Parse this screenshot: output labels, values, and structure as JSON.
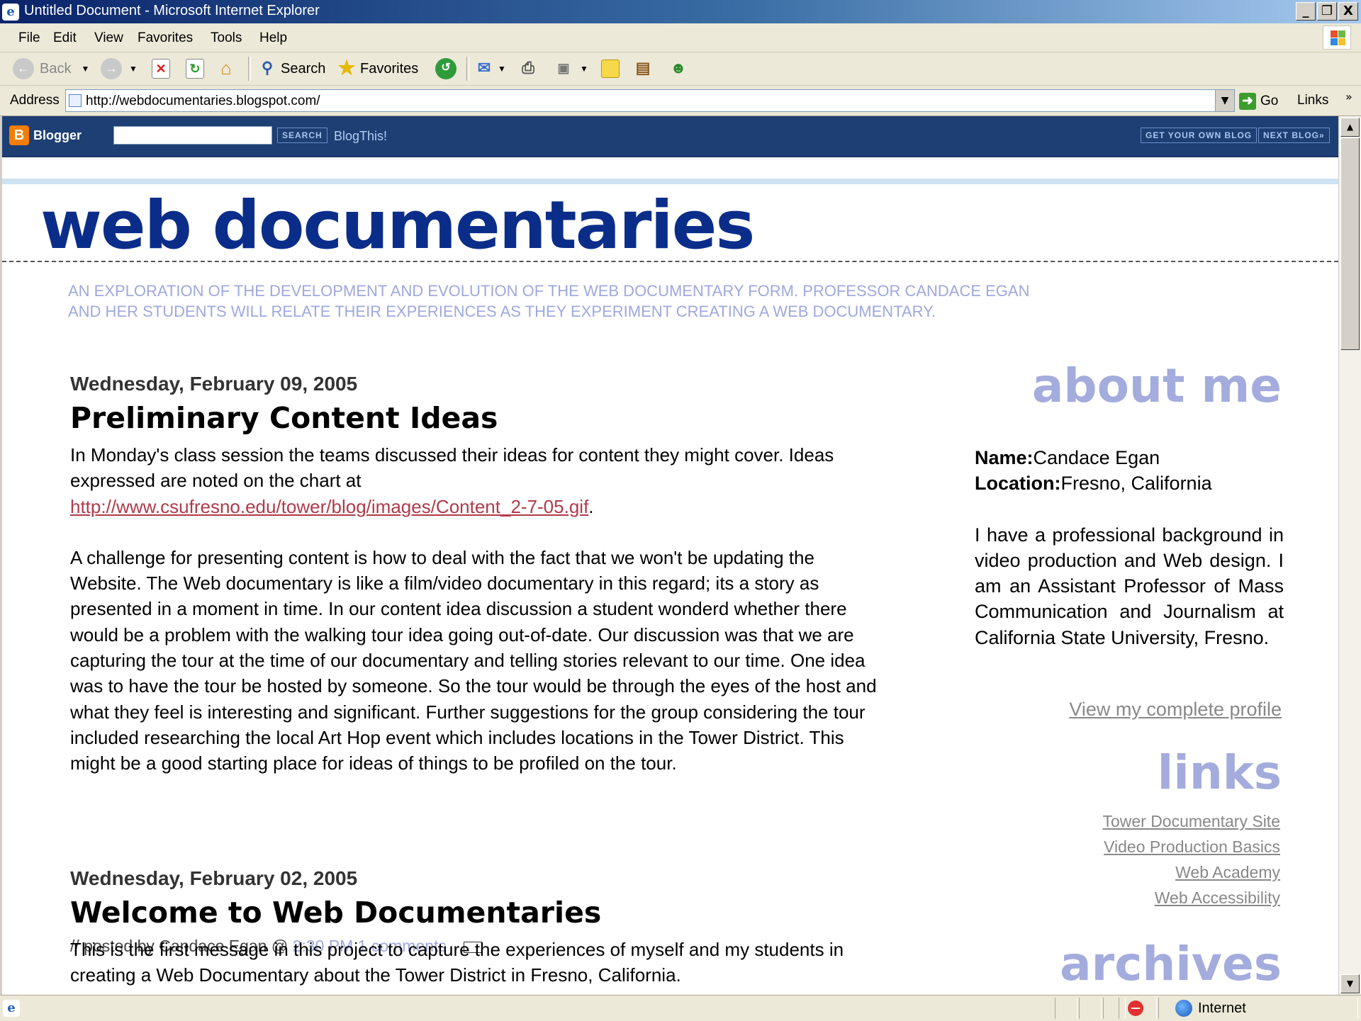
{
  "window": {
    "title": "Untitled Document - Microsoft Internet Explorer",
    "controls": [
      "_",
      "❐",
      "X"
    ]
  },
  "menu": [
    "File",
    "Edit",
    "View",
    "Favorites",
    "Tools",
    "Help"
  ],
  "toolbar": {
    "back": "Back",
    "search": "Search",
    "favorites": "Favorites"
  },
  "address": {
    "label": "Address",
    "url": "http://webdocumentaries.blogspot.com/",
    "go": "Go",
    "links": "Links"
  },
  "blogger_nav": {
    "logo": "Blogger",
    "search_button": "SEARCH",
    "blogthis": "BlogThis!",
    "get_blog": "GET YOUR OWN BLOG",
    "next_blog": "NEXT BLOG»"
  },
  "blog": {
    "title": "web documentaries",
    "tagline_1": "AN EXPLORATION OF THE DEVELOPMENT AND EVOLUTION OF THE WEB DOCUMENTARY FORM. PROFESSOR CANDACE EGAN",
    "tagline_2": "AND HER STUDENTS WILL RELATE THEIR EXPERIENCES AS THEY EXPERIMENT CREATING A WEB DOCUMENTARY."
  },
  "posts": [
    {
      "date": "Wednesday, February 09, 2005",
      "title": "Preliminary Content Ideas",
      "para1": "In Monday's class session the teams discussed their ideas for content they might cover. Ideas expressed are noted on the chart at",
      "link": "http://www.csufresno.edu/tower/blog/images/Content_2-7-05.gif",
      "para2": "A challenge for presenting content is how to deal with the fact that we won't be updating the Website. The Web documentary is like a film/video documentary in this regard; its a story as presented in a moment in time. In our content idea discussion a student wonderd whether there would be a problem with the walking tour idea going out-of-date. Our discussion was that we are capturing the tour at the time of our documentary and telling stories relevant to our time. One idea was to have the tour be hosted by someone. So the tour would be through the eyes of the host and what they feel is interesting and significant. Further suggestions for the group considering the tour included researching the local Art Hop event which includes locations in the Tower District. This might be a good starting place for ideas of things to be profiled on the tour.",
      "posted_by": "// posted by Candace Egan @",
      "time": "2:30 PM",
      "comments": "1 comments"
    },
    {
      "date": "Wednesday, February 02, 2005",
      "title": "Welcome to Web Documentaries",
      "para1": "This is the first message in this project to capture the experiences of myself and my students in creating a Web Documentary about the Tower District in Fresno, California."
    }
  ],
  "sidebar": {
    "about_heading": "about me",
    "name_label": "Name:",
    "name": "Candace Egan",
    "location_label": "Location:",
    "location": "Fresno, California",
    "bio": "I have a professional background in video production and Web design. I am an Assistant Professor of Mass Communication and Journalism at California State University, Fresno.",
    "view_profile": "View my complete profile",
    "links_heading": "links",
    "links": [
      "Tower Documentary Site",
      "Video Production Basics",
      "Web Academy",
      "Web Accessibility"
    ],
    "archives_heading": "archives"
  },
  "status": {
    "zone": "Internet"
  }
}
